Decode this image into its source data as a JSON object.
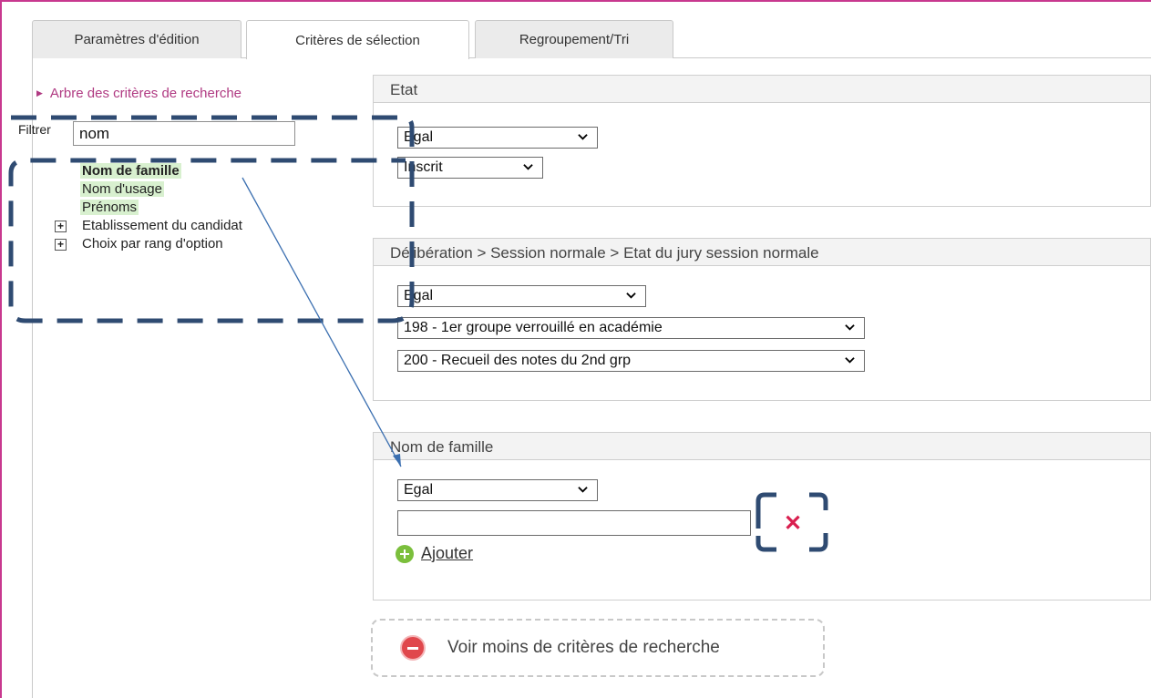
{
  "tabs": [
    {
      "label": "Paramètres d'édition"
    },
    {
      "label": "Critères de sélection"
    },
    {
      "label": "Regroupement/Tri"
    }
  ],
  "tree": {
    "title": "Arbre des critères de recherche",
    "filter_label": "Filtrer",
    "filter_value": "nom",
    "items": [
      {
        "label": "Nom de famille"
      },
      {
        "label": "Nom d'usage"
      },
      {
        "label": "Prénoms"
      },
      {
        "label": "Etablissement du candidat"
      },
      {
        "label": "Choix par rang d'option"
      }
    ]
  },
  "panels": {
    "etat": {
      "title": "Etat",
      "operator": "Egal",
      "value": "Inscrit"
    },
    "deliberation": {
      "title": "Délibération > Session normale > Etat du jury session normale",
      "operator": "Egal",
      "values": [
        "198 - 1er groupe verrouillé en académie",
        "200 - Recueil des notes du 2nd grp"
      ]
    },
    "nom_famille": {
      "title": "Nom de famille",
      "operator": "Egal",
      "input_value": "",
      "add_label": "Ajouter"
    }
  },
  "less_criteria_label": "Voir moins de critères de recherche",
  "colors": {
    "accent": "#b03a82",
    "frame": "#c8388f",
    "annotation": "#2f4b72",
    "highlight": "#d8f0cf",
    "remove": "#d91f4f",
    "add": "#7bbf3c"
  }
}
